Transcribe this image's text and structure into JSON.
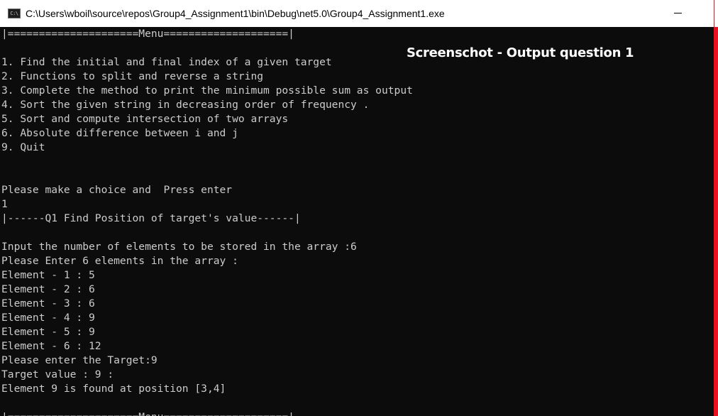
{
  "window": {
    "title": "C:\\Users\\wboil\\source\\repos\\Group4_Assignment1\\bin\\Debug\\net5.0\\Group4_Assignment1.exe",
    "icon_label": "C:\\",
    "icon_name": "console-app-icon",
    "minimize_icon": "minimize-icon"
  },
  "caption": "Screenschot - Output question 1",
  "console": {
    "menu_header": "|=====================Menu====================|",
    "menu_items": [
      "1. Find the initial and final index of a given target",
      "2. Functions to split and reverse a string",
      "3. Complete the method to print the minimum possible sum as output",
      "4. Sort the given string in decreasing order of frequency .",
      "5. Sort and compute intersection of two arrays",
      "6. Absolute difference between i and j",
      "9. Quit"
    ],
    "prompt": "Please make a choice and  Press enter",
    "choice": "1",
    "q1_header": "|------Q1 Find Position of target's value------|",
    "count_prompt": "Input the number of elements to be stored in the array :6",
    "enter_prompt": "Please Enter 6 elements in the array :",
    "elements": [
      "Element - 1 : 5",
      "Element - 2 : 6",
      "Element - 3 : 6",
      "Element - 4 : 9",
      "Element - 5 : 9",
      "Element - 6 : 12"
    ],
    "target_prompt": "Please enter the Target:9",
    "target_value": "Target value : 9 :",
    "result": "Element 9 is found at position [3,4]",
    "menu_header_repeat": "|=====================Menu====================|"
  },
  "colors": {
    "console_bg": "#0c0c0c",
    "console_text": "#cccccc",
    "titlebar_bg": "#ffffff",
    "accent_edge": "#e81123"
  }
}
